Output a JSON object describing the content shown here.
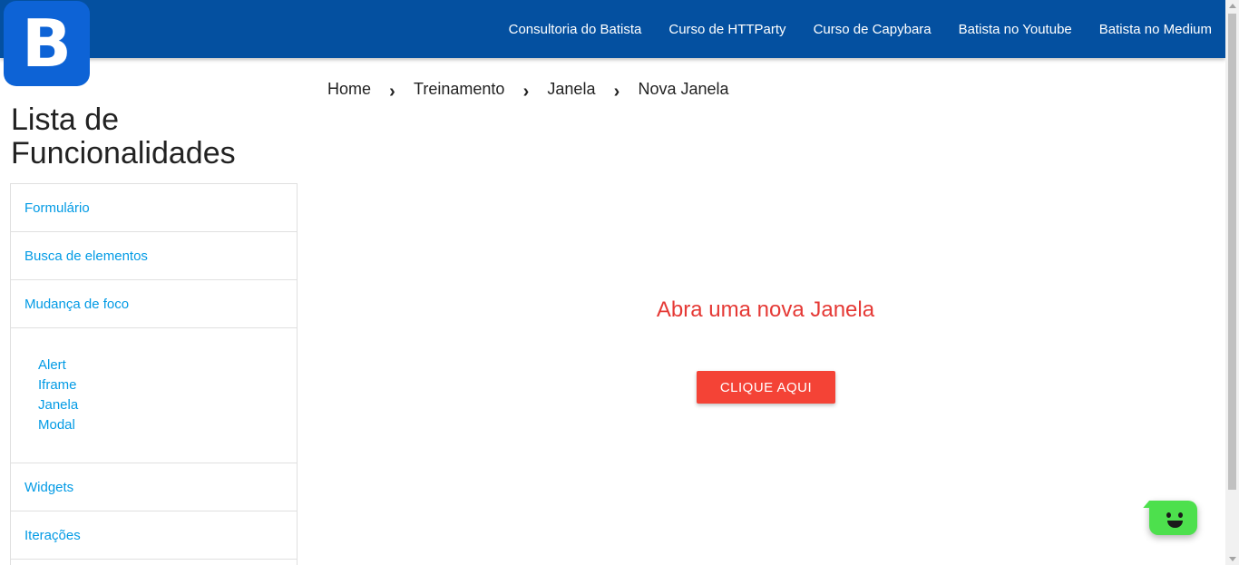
{
  "header": {
    "logo_letter": "B",
    "nav_links": [
      "Consultoria do Batista",
      "Curso de HTTParty",
      "Curso de Capybara",
      "Batista no Youtube",
      "Batista no Medium"
    ],
    "brand_color": "#0450a0"
  },
  "sidebar": {
    "title": "Lista de Funcionalidades",
    "items": [
      "Formulário",
      "Busca de elementos",
      "Mudança de foco"
    ],
    "sub_items": [
      "Alert",
      "Iframe",
      "Janela",
      "Modal"
    ],
    "items_after": [
      "Widgets",
      "Iterações"
    ],
    "link_color": "#039be5"
  },
  "breadcrumb": {
    "items": [
      "Home",
      "Treinamento",
      "Janela",
      "Nova Janela"
    ],
    "separator_icon": "chevron-right-icon"
  },
  "main": {
    "headline": "Abra uma nova Janela",
    "button_label": "CLIQUE AQUI",
    "accent_color": "#f44336"
  },
  "chat_widget": {
    "icon": "smiley-chat-icon",
    "color": "#4de04d"
  }
}
